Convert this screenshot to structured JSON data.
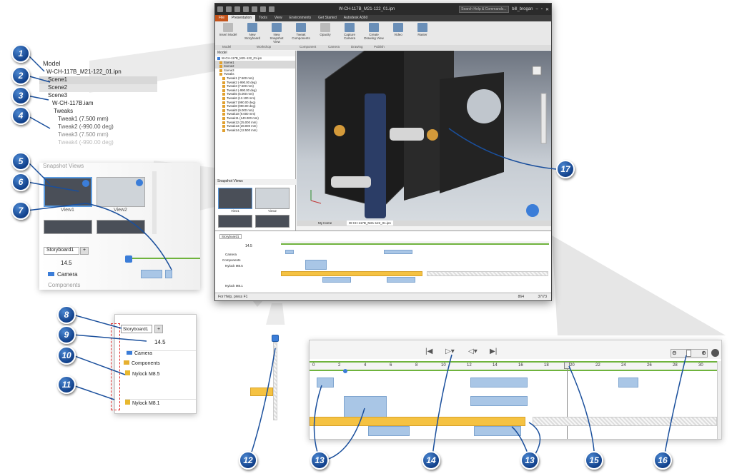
{
  "window": {
    "title_file": "W-CH-117B_M21-122_01.ipn",
    "search_placeholder": "Search Help & Commands...",
    "user": "bill_brogan",
    "ribbon_tabs": [
      "File",
      "Presentation",
      "Tools",
      "View",
      "Environments",
      "Get Started",
      "Autodesk A360"
    ],
    "ribbon_buttons": [
      {
        "label": "Insert Model"
      },
      {
        "label": "New Storyboard"
      },
      {
        "label": "New Snapshot View"
      },
      {
        "label": "Tweak Components"
      },
      {
        "label": "Opacity"
      },
      {
        "label": "Capture Camera"
      },
      {
        "label": "Create Drawing View"
      },
      {
        "label": "Video"
      },
      {
        "label": "Raster"
      }
    ],
    "ribbon_groups": [
      "Model",
      "Workshop",
      "Component",
      "Camera",
      "Drawing",
      "Publish"
    ],
    "status_left": "For Help, press F1",
    "status_right_1": "864",
    "status_right_2": "37/73",
    "viewport_tabs": [
      "My Home",
      "W-CH-117B_M21-122_01.ipn"
    ]
  },
  "model_tree": {
    "header": "Model",
    "rows": [
      "W-CH-117B_M21-122_01.ipn",
      "Scene1",
      "Scene2",
      "Scene3",
      "Tweaks",
      "Tweak1 (7.500 mm)",
      "Tweak2 (-990.00 deg)",
      "Tweak3 (7.500 mm)",
      "Tweak4 (-990.00 deg)",
      "Tweak5 (5.000 mm)",
      "Tweak6 (12.100 mm)",
      "Tweak7 (990.00 deg)",
      "Tweak8 (990.00 deg)",
      "Tweak9 (9.000 mm)",
      "Tweak10 (9.000 mm)",
      "Tweak11 (140.000 mm)",
      "Tweak12 (25.000 mm)",
      "Tweak13 (28.000 mm)",
      "Tweak14 (12.500 mm)"
    ]
  },
  "zoom_tree": {
    "header": "Model",
    "rows": [
      "W-CH-117B_M21-122_01.ipn",
      "Scene1",
      "Scene2",
      "Scene3",
      "W-CH-117B.iam",
      "Tweaks",
      "Tweak1 (7.500 mm)",
      "Tweak2 (-990.00 deg)",
      "Tweak3 (7.500 mm)",
      "Tweak4 (-990.00 deg)"
    ]
  },
  "snapshots": {
    "header": "Snapshot Views",
    "items": [
      "View1",
      "View2"
    ]
  },
  "storyboard": {
    "tab": "Storyboard1",
    "add_tab": "+",
    "time": "14.5",
    "rows": [
      "Camera",
      "Components",
      "Nylock M8.5",
      "Nylock M8.1"
    ]
  },
  "timeline": {
    "ticks": [
      "0",
      "2",
      "4",
      "6",
      "8",
      "10",
      "12",
      "14",
      "16",
      "18",
      "20",
      "22",
      "24",
      "26",
      "28",
      "30"
    ]
  },
  "callouts": [
    "1",
    "2",
    "3",
    "4",
    "5",
    "6",
    "7",
    "8",
    "9",
    "10",
    "11",
    "12",
    "13",
    "14",
    "13",
    "15",
    "16",
    "17"
  ],
  "colors": {
    "badge": "#1a4f9c",
    "track_blue": "#a9c6e6",
    "track_yellow": "#f5c242",
    "ruler_green": "#6fb33d",
    "file_tab": "#c4531a"
  }
}
